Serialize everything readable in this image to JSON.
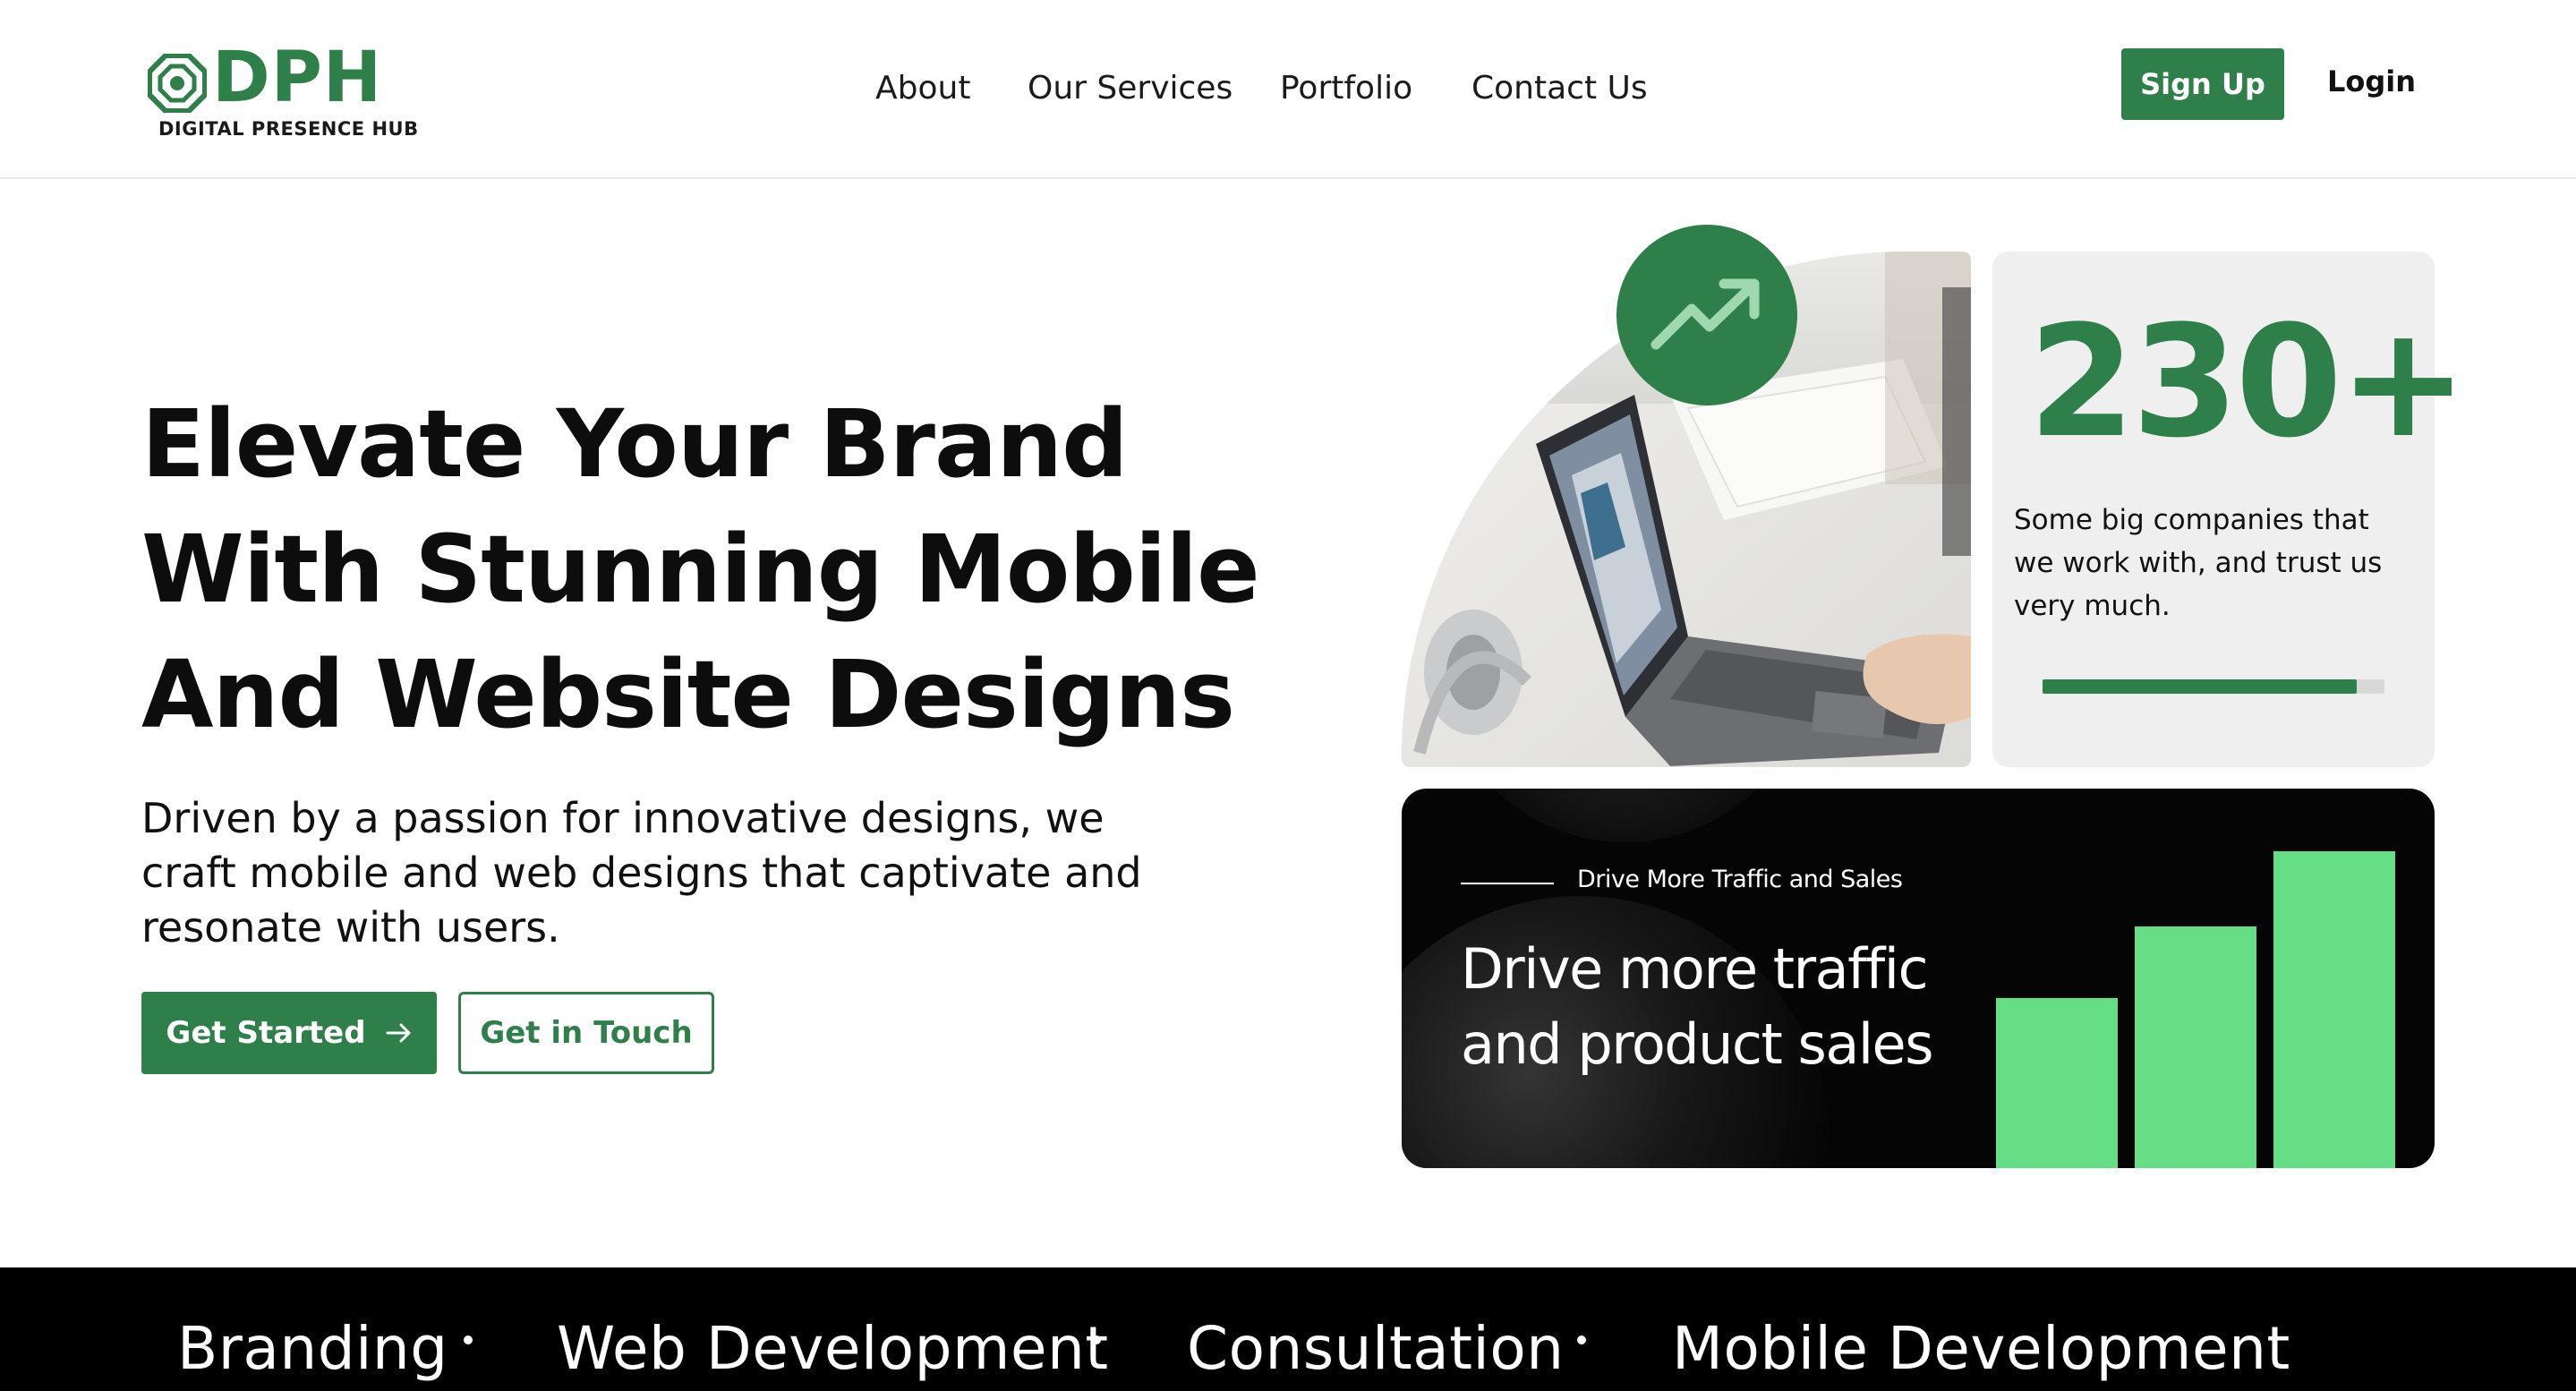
{
  "brand": {
    "wordmark": "DPH",
    "tagline": "DIGITAL PRESENCE HUB",
    "accent_color": "#2f7f4a",
    "bar_color": "#66de85"
  },
  "nav": {
    "items": [
      {
        "label": "About"
      },
      {
        "label": "Our Services"
      },
      {
        "label": "Portfolio"
      },
      {
        "label": "Contact Us"
      }
    ],
    "signup_label": "Sign Up",
    "login_label": "Login"
  },
  "hero": {
    "title_lines": [
      "Elevate Your Brand",
      "With Stunning Mobile",
      "And Website Designs"
    ],
    "subtitle": "Driven by a passion for innovative designs, we craft mobile and web designs that captivate and resonate with users.",
    "primary_cta": "Get Started",
    "primary_cta_icon": "arrow-right-icon",
    "secondary_cta": "Get in Touch"
  },
  "photo_card": {
    "badge_icon": "trending-up-icon",
    "image_desc_icon": "laptop-photo"
  },
  "stat_card": {
    "number": "230+",
    "text": "Some big companies that we work with, and trust us very much.",
    "progress_fraction": 0.92
  },
  "traffic_card": {
    "eyebrow": "Drive More Traffic and Sales",
    "title": "Drive more traffic and product sales",
    "bar_levels": [
      0.43,
      0.61,
      0.8
    ]
  },
  "services_strip": {
    "items": [
      "Branding",
      "Web Development",
      "Consultation",
      "Mobile Development"
    ]
  }
}
